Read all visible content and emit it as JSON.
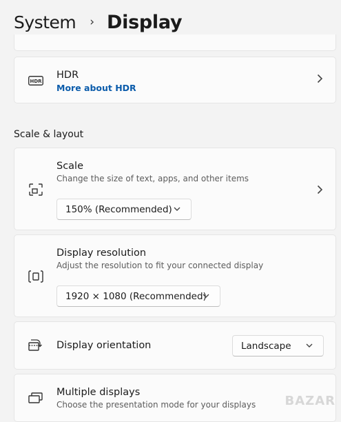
{
  "breadcrumb": {
    "parent": "System",
    "separator": "›",
    "current": "Display"
  },
  "hdr": {
    "title": "HDR",
    "link": "More about HDR"
  },
  "section": {
    "scale_layout": "Scale & layout"
  },
  "scale": {
    "title": "Scale",
    "desc": "Change the size of text, apps, and other items",
    "value": "150% (Recommended)"
  },
  "resolution": {
    "title": "Display resolution",
    "desc": "Adjust the resolution to fit your connected display",
    "value": "1920 × 1080 (Recommended)"
  },
  "orientation": {
    "title": "Display orientation",
    "value": "Landscape"
  },
  "multiple": {
    "title": "Multiple displays",
    "desc": "Choose the presentation mode for your displays"
  },
  "watermark": "BAZAR",
  "icons": [
    "hdr-icon",
    "scale-icon",
    "resolution-icon",
    "orientation-icon",
    "multiple-displays-icon",
    "chevron-right-icon",
    "chevron-down-icon"
  ]
}
